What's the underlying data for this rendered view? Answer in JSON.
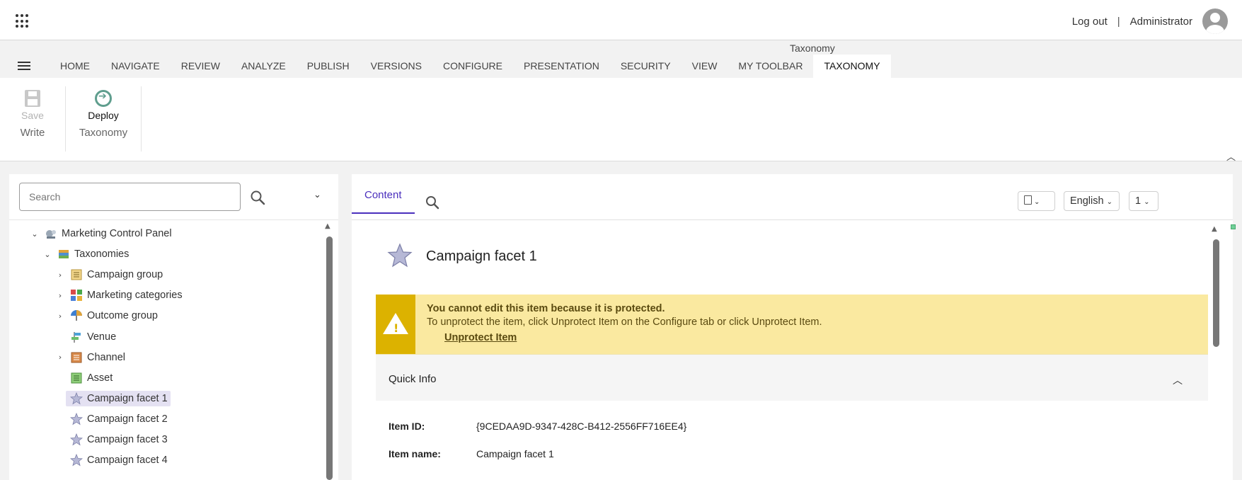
{
  "topbar": {
    "logout": "Log out",
    "separator": "|",
    "user": "Administrator"
  },
  "ribbon_tabs": {
    "context_label": "Taxonomy",
    "tabs": [
      "HOME",
      "NAVIGATE",
      "REVIEW",
      "ANALYZE",
      "PUBLISH",
      "VERSIONS",
      "CONFIGURE",
      "PRESENTATION",
      "SECURITY",
      "VIEW",
      "MY TOOLBAR",
      "TAXONOMY"
    ],
    "active": "TAXONOMY"
  },
  "ribbon": {
    "save_label": "Save",
    "write_group": "Write",
    "deploy_label": "Deploy",
    "taxonomy_group": "Taxonomy"
  },
  "tree_panel": {
    "search_placeholder": "Search",
    "items": [
      {
        "label": "Marketing Control Panel",
        "icon": "control-panel-icon"
      },
      {
        "label": "Taxonomies",
        "icon": "books-icon"
      },
      {
        "label": "Campaign group",
        "icon": "folder-list-icon"
      },
      {
        "label": "Marketing categories",
        "icon": "cubes-icon"
      },
      {
        "label": "Outcome group",
        "icon": "umbrella-icon"
      },
      {
        "label": "Venue",
        "icon": "signpost-icon"
      },
      {
        "label": "Channel",
        "icon": "channel-icon"
      },
      {
        "label": "Asset",
        "icon": "asset-icon"
      },
      {
        "label": "Campaign facet 1",
        "icon": "star-icon",
        "selected": true
      },
      {
        "label": "Campaign facet 2",
        "icon": "star-icon"
      },
      {
        "label": "Campaign facet 3",
        "icon": "star-icon"
      },
      {
        "label": "Campaign facet 4",
        "icon": "star-icon"
      }
    ]
  },
  "content_panel": {
    "tab_content": "Content",
    "language": "English",
    "version": "1",
    "item_title": "Campaign facet 1",
    "warning": {
      "title": "You cannot edit this item because it is protected.",
      "text": "To unprotect the item, click Unprotect Item on the Configure tab or click Unprotect Item.",
      "link": "Unprotect Item"
    },
    "quick_info": "Quick Info",
    "fields": [
      {
        "key": "Item ID:",
        "value": "{9CEDAA9D-9347-428C-B412-2556FF716EE4}"
      },
      {
        "key": "Item name:",
        "value": "Campaign facet 1"
      }
    ]
  },
  "colors": {
    "accent": "#4a2fbd",
    "warning_bg": "#fae9a0",
    "warning_icon_bg": "#dcb200",
    "selected_bg": "#e4e1f2"
  }
}
